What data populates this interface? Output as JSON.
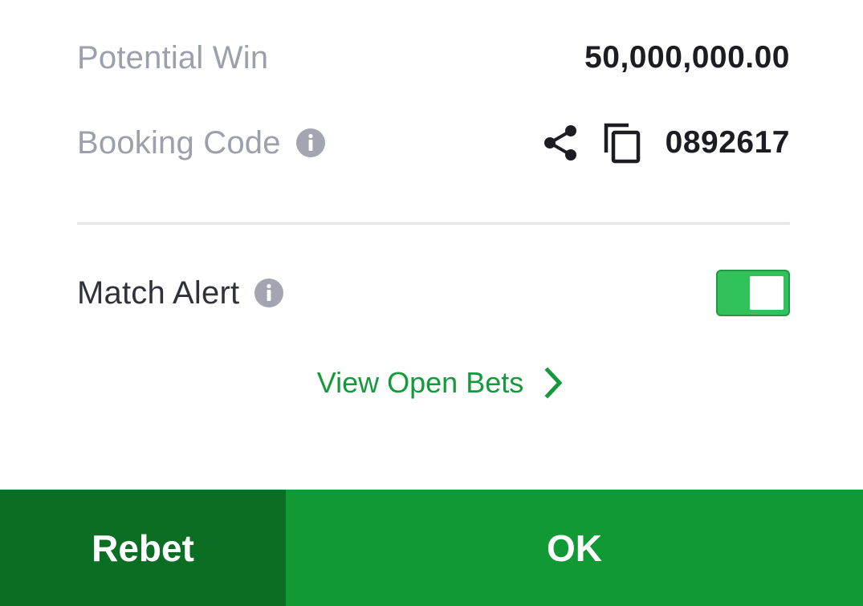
{
  "potential_win": {
    "label": "Potential Win",
    "value": "50,000,000.00"
  },
  "booking_code": {
    "label": "Booking Code",
    "info_icon": "info-icon",
    "share_icon": "share-icon",
    "copy_icon": "copy-icon",
    "code": "0892617"
  },
  "match_alert": {
    "label": "Match Alert",
    "info_icon": "info-icon",
    "toggle_on": true
  },
  "view_open_bets": {
    "label": "View Open Bets",
    "icon": "chevron-right-icon"
  },
  "footer": {
    "rebet_label": "Rebet",
    "ok_label": "OK"
  },
  "colors": {
    "brand_green": "#119934",
    "dark_green": "#0c6e24",
    "toggle_green": "#32c25b",
    "link_green": "#149a3a",
    "muted_text": "#9ca0ab"
  }
}
